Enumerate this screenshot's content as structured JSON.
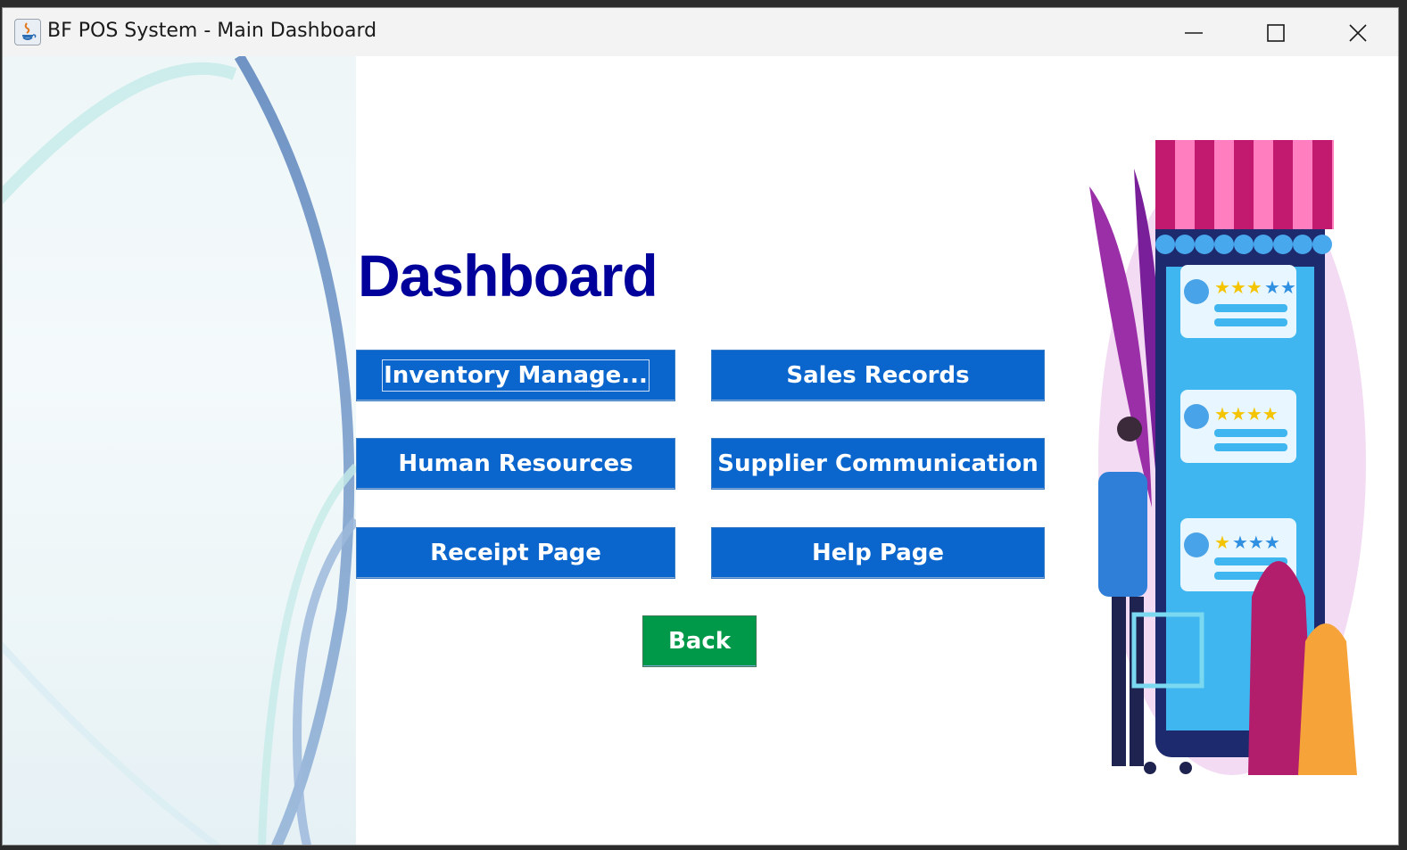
{
  "window": {
    "title": "BF POS System - Main Dashboard",
    "controls": [
      "minimize-icon",
      "maximize-icon",
      "close-icon"
    ]
  },
  "main": {
    "heading": "Dashboard",
    "buttons": {
      "inventory": "Inventory Manage...",
      "sales": "Sales Records",
      "hr": "Human Resources",
      "supplier": "Supplier Communication",
      "receipt": "Receipt Page",
      "help": "Help Page",
      "back": "Back"
    }
  },
  "colors": {
    "heading": "#00009a",
    "button_blue": "#0a66cc",
    "button_green": "#00994a",
    "button_text": "#ffffff"
  }
}
